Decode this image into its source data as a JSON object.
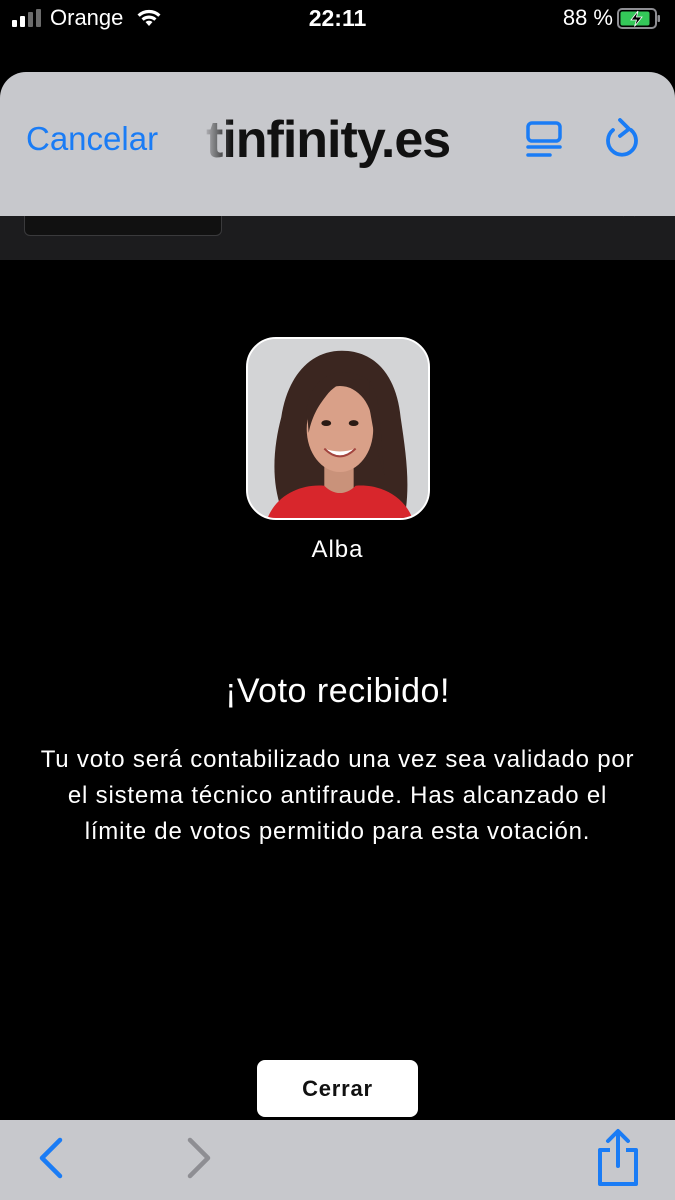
{
  "status_bar": {
    "carrier": "Orange",
    "time": "22:11",
    "battery_percent": "88 %",
    "battery_level": 0.88,
    "charging": true
  },
  "browser": {
    "cancel_label": "Cancelar",
    "url": "tinfinity.es",
    "reader_icon": "reader-icon",
    "reload_icon": "reload-icon",
    "accent_color": "#1a7cf5"
  },
  "vote": {
    "contestant_name": "Alba",
    "title": "¡Voto recibido!",
    "body": "Tu voto será contabilizado una vez sea validado por el sistema técnico antifraude. Has alcanzado el límite de votos permitido para esta votación.",
    "close_label": "Cerrar"
  },
  "toolbar": {
    "back_icon": "chevron-left-icon",
    "forward_icon": "chevron-right-icon",
    "share_icon": "share-icon"
  }
}
